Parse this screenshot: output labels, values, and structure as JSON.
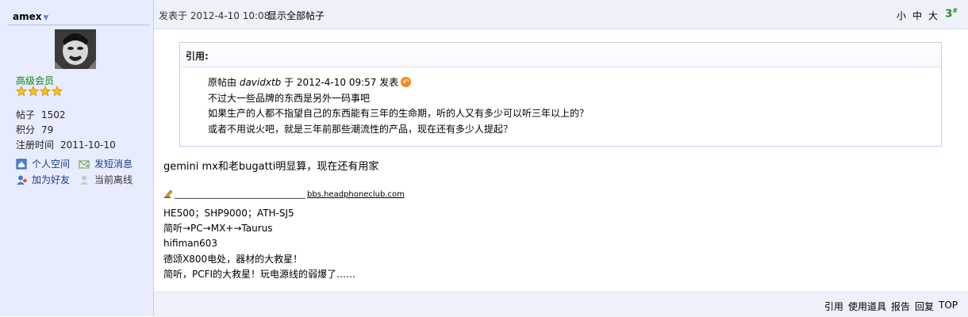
{
  "user": {
    "name": "amex",
    "rank": "高级会员",
    "stars": 4,
    "stats": [
      {
        "label": "帖子",
        "value": "1502"
      },
      {
        "label": "积分",
        "value": "79"
      },
      {
        "label": "注册时间",
        "value": "2011-10-10"
      }
    ],
    "actions": {
      "space": "个人空间",
      "message": "发短消息",
      "friend": "加为好友",
      "status": "当前离线"
    }
  },
  "post": {
    "posted_at": "发表于 2012-4-10 10:08",
    "show_all": "显示全部帖子",
    "font_small": "小",
    "font_medium": "中",
    "font_large": "大",
    "floor": "3",
    "floor_sup": "#"
  },
  "quote": {
    "title": "引用:",
    "by_prefix": "原帖由 ",
    "by_user": "davidxtb",
    "by_suffix": " 于 2012-4-10 09:57 发表",
    "lines": [
      "不过大一些品牌的东西是另外一码事吧",
      "如果生产的人都不指望自己的东西能有三年的生命期，听的人又有多少可以听三年以上的？",
      "或者不用说火吧，就是三年前那些潮流性的产品，现在还有多少人提起？"
    ]
  },
  "message": "gemini mx和老bugatti明显算，现在还有用家",
  "signature": {
    "dashes": "______________________________",
    "site": "bbs.headphoneclub.com",
    "lines": [
      "HE500；SHP9000；ATH-SJ5",
      "简听→PC→MX+→Taurus",
      "hifiman603",
      "德颂X800电处，器材的大救星！",
      "简听，PCFI的大救星！玩电源线的弱爆了……"
    ]
  },
  "footer": {
    "quote": "引用",
    "use_tool": "使用道具",
    "report": "报告",
    "reply": "回复",
    "top": "TOP"
  }
}
